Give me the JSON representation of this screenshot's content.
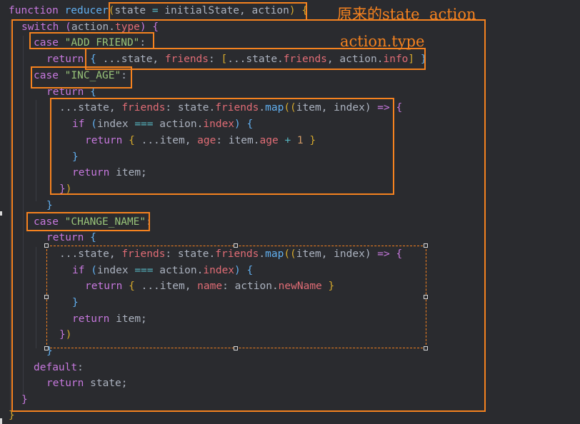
{
  "code": {
    "line1": {
      "kw": "function",
      "fn": "reducer",
      "open": "(",
      "p1": "state",
      "eq": "=",
      "p2": "initialState,",
      "p3": "action",
      "close": ")",
      "brace": "{"
    },
    "line2": {
      "kw": "switch",
      "open": "(",
      "obj": "action",
      "dot": ".",
      "prop": "type",
      "close": ")",
      "brace": "{"
    },
    "line3": {
      "kw": "case",
      "str": "\"ADD_FRIEND\"",
      "colon": ":"
    },
    "line4": {
      "kw": "return",
      "open": "{",
      "spread": "...state,",
      "prop": "friends",
      "colon": ":",
      "arrOpen": "[",
      "spread2": "...state.",
      "prop2": "friends",
      "comma": ",",
      "obj": "action.",
      "prop3": "info",
      "arrClose": "]",
      "close": "}"
    },
    "line5": {
      "kw": "case",
      "str": "\"INC_AGE\"",
      "colon": ":"
    },
    "line6": {
      "kw": "return",
      "brace": "{"
    },
    "line7": {
      "spread": "...state,",
      "prop": "friends",
      "colon": ":",
      "obj": "state.",
      "prop2": "friends",
      "dot": ".",
      "fn": "map",
      "open": "((",
      "args": "item, index)",
      "arrow": "=>",
      "brace": "{"
    },
    "line8": {
      "kw": "if",
      "open": "(",
      "a": "index",
      "op": "===",
      "obj": "action.",
      "prop": "index",
      "close": ")",
      "brace": "{"
    },
    "line9": {
      "kw": "return",
      "open": "{",
      "spread": "...item,",
      "prop": "age",
      "colon": ":",
      "obj": "item.",
      "prop2": "age",
      "plus": "+",
      "num": "1",
      "close": "}"
    },
    "line10": {
      "brace": "}"
    },
    "line11": {
      "kw": "return",
      "rest": "item;"
    },
    "line12": {
      "brace": "}",
      "paren": ")"
    },
    "line13": {
      "brace": "}"
    },
    "line14": {
      "kw": "case",
      "str": "\"CHANGE_NAME\"",
      "colon": ":"
    },
    "line15": {
      "kw": "return",
      "brace": "{"
    },
    "line16": {
      "spread": "...state,",
      "prop": "friends",
      "colon": ":",
      "obj": "state.",
      "prop2": "friends",
      "dot": ".",
      "fn": "map",
      "open": "((",
      "args": "item, index)",
      "arrow": "=>",
      "brace": "{"
    },
    "line17": {
      "kw": "if",
      "open": "(",
      "a": "index",
      "op": "===",
      "obj": "action.",
      "prop": "index",
      "close": ")",
      "brace": "{"
    },
    "line18": {
      "kw": "return",
      "open": "{",
      "spread": "...item,",
      "prop": "name",
      "colon": ":",
      "obj": "action.",
      "prop2": "newName",
      "close": "}"
    },
    "line19": {
      "brace": "}"
    },
    "line20": {
      "kw": "return",
      "rest": "item;"
    },
    "line21": {
      "brace": "}",
      "paren": ")"
    },
    "line22": {
      "brace": "}"
    },
    "line23": {
      "kw": "default",
      "colon": ":"
    },
    "line24": {
      "kw": "return",
      "rest": "state;"
    },
    "line25": {
      "brace": "}"
    },
    "line26": {
      "brace": "}"
    }
  },
  "annotations": {
    "note_state_action": "原来的state  action",
    "note_action_type": "action.type"
  },
  "colors": {
    "annotation": "#f5821f",
    "background": "#2a2b2f"
  }
}
